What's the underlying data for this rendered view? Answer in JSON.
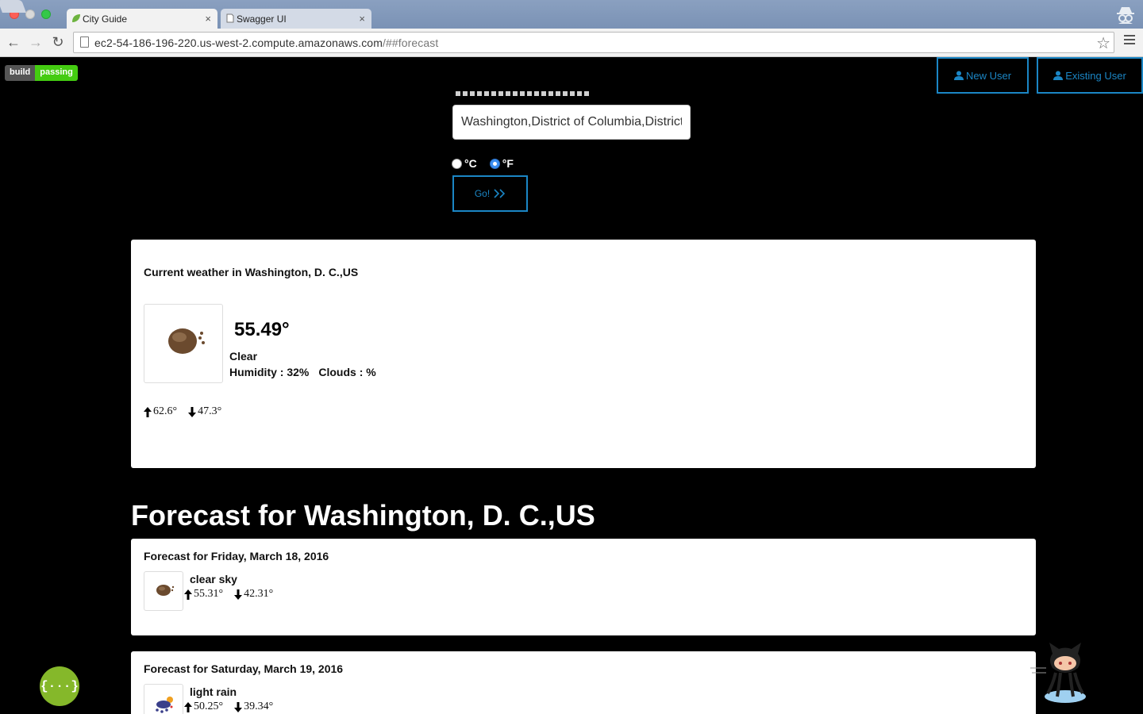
{
  "browser": {
    "tabs": [
      {
        "title": "City Guide",
        "active": true
      },
      {
        "title": "Swagger UI",
        "active": false
      }
    ],
    "url_host": "ec2-54-186-196-220.us-west-2.compute.amazonaws.com",
    "url_path": "/##forecast"
  },
  "badge": {
    "left": "build",
    "right": "passing"
  },
  "user_buttons": {
    "new": "New User",
    "existing": "Existing User"
  },
  "search": {
    "value": "Washington,District of Columbia,District"
  },
  "units": {
    "celsius": "°C",
    "fahrenheit": "°F",
    "selected": "fahrenheit"
  },
  "go_button": "Go!",
  "current": {
    "title": "Current weather in Washington, D. C.,US",
    "temperature": "55.49°",
    "condition": "Clear",
    "humidity": "Humidity : 32%",
    "clouds": "Clouds : %",
    "high": "62.6°",
    "low": "47.3°",
    "icon": "clear-night-icon"
  },
  "forecast_heading": "Forecast for Washington, D. C.,US",
  "forecast": [
    {
      "title": "Forecast for Friday, March 18, 2016",
      "description": "clear sky",
      "high": "55.31°",
      "low": "42.31°",
      "icon": "clear-sky-icon"
    },
    {
      "title": "Forecast for Saturday, March 19, 2016",
      "description": "light rain",
      "high": "50.25°",
      "low": "39.34°",
      "icon": "light-rain-icon"
    }
  ],
  "colors": {
    "accent": "#1b86c5",
    "badge_pass": "#44cc11",
    "swagger": "#85b82a"
  }
}
